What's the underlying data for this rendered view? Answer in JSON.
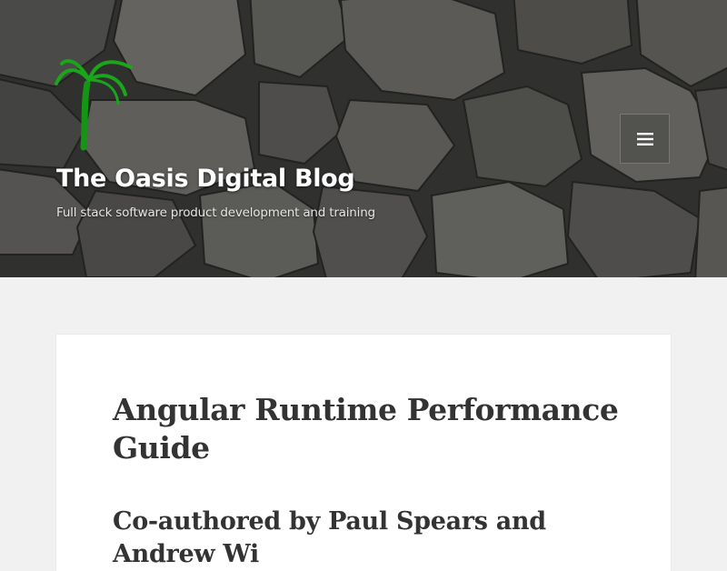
{
  "header": {
    "site_title": "The Oasis Digital Blog",
    "site_description": "Full stack software product development and training",
    "logo_icon": "palm-tree-icon",
    "menu_icon": "hamburger-menu-icon"
  },
  "post": {
    "title": "Angular Runtime Performance Guide",
    "subheading": "Co-authored by Paul Spears and Andrew Wi"
  },
  "colors": {
    "page_background": "#f1f1f1",
    "card_background": "#ffffff",
    "title_text": "#333333",
    "header_text": "#ffffff",
    "logo_green": "#1aa51a"
  }
}
